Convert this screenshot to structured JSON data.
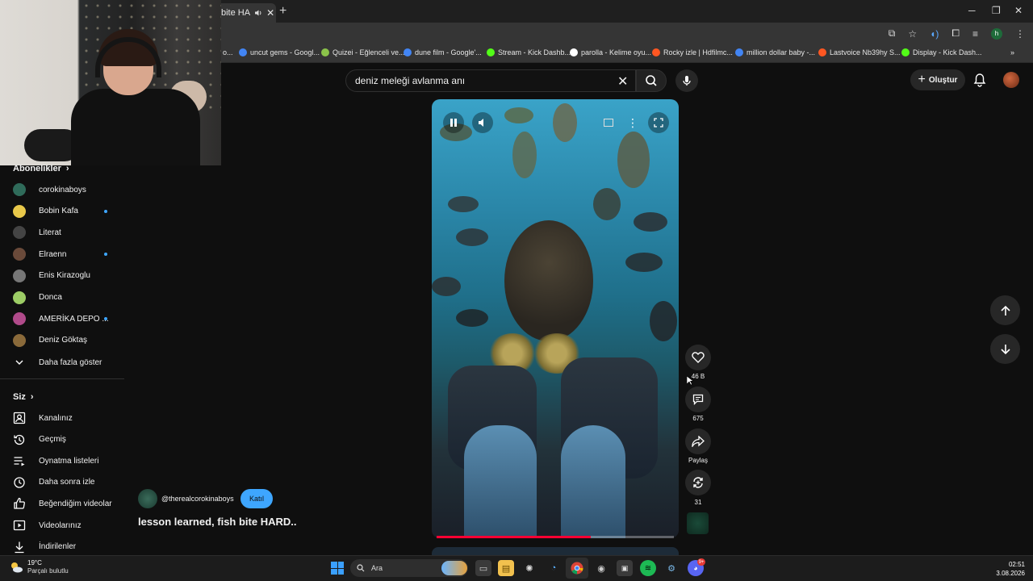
{
  "browser": {
    "tab_title": "bite HA",
    "bookmarks": [
      {
        "label": "o...",
        "color": "#888888"
      },
      {
        "label": "uncut gems - Googl...",
        "color": "#4285f4"
      },
      {
        "label": "Quizei - Eğlenceli ve...",
        "color": "#8bc34a"
      },
      {
        "label": "dune film - Google'...",
        "color": "#4285f4"
      },
      {
        "label": "Stream - Kick Dashb...",
        "color": "#53fc18"
      },
      {
        "label": "parolla - Kelime oyu...",
        "color": "#ffffff"
      },
      {
        "label": "Rocky izle | Hdfilmc...",
        "color": "#ff5722"
      },
      {
        "label": "million dollar baby -...",
        "color": "#4285f4"
      },
      {
        "label": "Lastvoice Nb39hy S...",
        "color": "#ff5722"
      },
      {
        "label": "Display - Kick Dash...",
        "color": "#53fc18"
      }
    ],
    "profile_letter": "h"
  },
  "header": {
    "search_query": "deniz meleği avlanma anı",
    "create_label": "Oluştur"
  },
  "sidebar": {
    "subscriptions_title": "Abonelikler",
    "subscriptions": [
      {
        "label": "corokinaboys",
        "color": "#2f6b5a",
        "dot": false
      },
      {
        "label": "Bobin Kafa",
        "color": "#e8c84a",
        "dot": true
      },
      {
        "label": "Literat",
        "color": "#444444",
        "dot": false
      },
      {
        "label": "Elraenn",
        "color": "#6a4a3a",
        "dot": true
      },
      {
        "label": "Enis Kirazoglu",
        "color": "#777777",
        "dot": false
      },
      {
        "label": "Donca",
        "color": "#9ccc65",
        "dot": false
      },
      {
        "label": "AMERİKA DEPO ...",
        "color": "#b04a8a",
        "dot": true
      },
      {
        "label": "Deniz Göktaş",
        "color": "#8a6a3a",
        "dot": false
      }
    ],
    "show_more": "Daha fazla göster",
    "you_title": "Siz",
    "you_items": [
      {
        "label": "Kanalınız",
        "icon": "channel-icon"
      },
      {
        "label": "Geçmiş",
        "icon": "history-icon"
      },
      {
        "label": "Oynatma listeleri",
        "icon": "playlist-icon"
      },
      {
        "label": "Daha sonra izle",
        "icon": "clock-icon"
      },
      {
        "label": "Beğendiğim videolar",
        "icon": "thumbs-up-icon"
      },
      {
        "label": "Videolarınız",
        "icon": "video-icon"
      },
      {
        "label": "İndirilenler",
        "icon": "download-icon"
      }
    ]
  },
  "short": {
    "channel": "@therealcorokinaboys",
    "join_label": "Katıl",
    "title": "lesson learned, fish bite HARD..",
    "likes": "46 B",
    "comments": "675",
    "share_label": "Paylaş",
    "remix_count": "31",
    "progress": 0.65
  },
  "taskbar": {
    "temperature": "19°C",
    "weather": "Parçalı bulutlu",
    "search_placeholder": "Ara",
    "time": "02:51",
    "date": "3.08.2026",
    "discord_badge": "9+"
  }
}
